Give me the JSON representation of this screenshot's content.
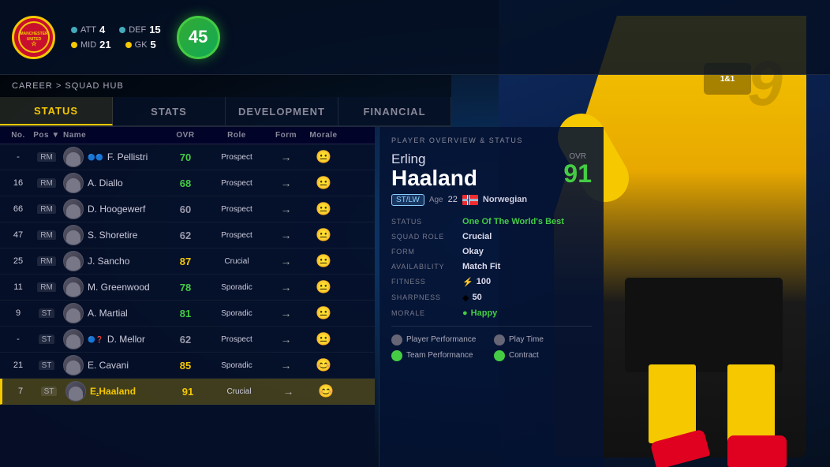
{
  "background": {
    "color": "#061428"
  },
  "topbar": {
    "club": "Manchester United",
    "stats": {
      "att_label": "ATT",
      "att_value": "4",
      "def_label": "DEF",
      "def_value": "15",
      "mid_label": "MID",
      "mid_value": "21",
      "gk_label": "GK",
      "gk_value": "5"
    },
    "overall": "45"
  },
  "breadcrumb": "CAREER > SQUAD HUB",
  "tabs": [
    {
      "label": "STATUS",
      "active": true
    },
    {
      "label": "STATS",
      "active": false
    },
    {
      "label": "DEVELOPMENT",
      "active": false
    },
    {
      "label": "FINANCIAL",
      "active": false
    }
  ],
  "table": {
    "headers": [
      "No.",
      "Pos ▼",
      "Name",
      "OVR",
      "Role",
      "Form",
      "Morale"
    ],
    "rows": [
      {
        "number": "-",
        "pos": "RM",
        "name": "F. Pellistri",
        "ovr": 70,
        "ovr_color": "green",
        "role": "Prospect",
        "form": "→",
        "morale": "😐",
        "selected": false,
        "special": "🔵🔵"
      },
      {
        "number": "16",
        "pos": "RM",
        "name": "A. Diallo",
        "ovr": 68,
        "ovr_color": "green",
        "role": "Prospect",
        "form": "→",
        "morale": "😐",
        "selected": false,
        "special": ""
      },
      {
        "number": "66",
        "pos": "RM",
        "name": "D. Hoogewerf",
        "ovr": 60,
        "ovr_color": "gray",
        "role": "Prospect",
        "form": "→",
        "morale": "😐",
        "selected": false,
        "special": ""
      },
      {
        "number": "47",
        "pos": "RM",
        "name": "S. Shoretire",
        "ovr": 62,
        "ovr_color": "gray",
        "role": "Prospect",
        "form": "→",
        "morale": "😐",
        "selected": false,
        "special": ""
      },
      {
        "number": "25",
        "pos": "RM",
        "name": "J. Sancho",
        "ovr": 87,
        "ovr_color": "yellow",
        "role": "Crucial",
        "form": "→",
        "morale": "😐",
        "selected": false,
        "special": ""
      },
      {
        "number": "11",
        "pos": "RM",
        "name": "M. Greenwood",
        "ovr": 78,
        "ovr_color": "green",
        "role": "Sporadic",
        "form": "→",
        "morale": "😐",
        "selected": false,
        "special": ""
      },
      {
        "number": "9",
        "pos": "ST",
        "name": "A. Martial",
        "ovr": 81,
        "ovr_color": "green",
        "role": "Sporadic",
        "form": "→",
        "morale": "😐",
        "selected": false,
        "special": ""
      },
      {
        "number": "-",
        "pos": "ST",
        "name": "D. Mellor",
        "ovr": 62,
        "ovr_color": "gray",
        "role": "Prospect",
        "form": "→",
        "morale": "😐",
        "selected": false,
        "special": "🔵❓"
      },
      {
        "number": "21",
        "pos": "ST",
        "name": "E. Cavani",
        "ovr": 85,
        "ovr_color": "yellow",
        "role": "Sporadic",
        "form": "→",
        "morale": "😊",
        "selected": false,
        "special": ""
      },
      {
        "number": "7",
        "pos": "ST",
        "name": "E.Haaland",
        "ovr": 91,
        "ovr_color": "yellow",
        "role": "Crucial",
        "form": "→",
        "morale": "😊",
        "selected": true,
        "special": ""
      }
    ]
  },
  "overview": {
    "title": "PLAYER OVERVIEW & STATUS",
    "first_name": "Erling",
    "last_name": "Haaland",
    "ovr_label": "OVR",
    "ovr_value": "91",
    "position": "ST/LW",
    "age_label": "Age",
    "age": "22",
    "nationality": "Norwegian",
    "stats": [
      {
        "key": "STATUS",
        "value": "One Of The World's Best",
        "color": "green"
      },
      {
        "key": "SQUAD ROLE",
        "value": "Crucial",
        "color": "white"
      },
      {
        "key": "FORM",
        "value": "Okay",
        "color": "white"
      },
      {
        "key": "AVAILABILITY",
        "value": "Match Fit",
        "color": "white"
      },
      {
        "key": "FITNESS",
        "value": "100",
        "icon": "⚡",
        "color": "white"
      },
      {
        "key": "SHARPNESS",
        "value": "50",
        "icon": "◆",
        "color": "white"
      },
      {
        "key": "MORALE",
        "value": "Happy",
        "icon": "●",
        "color": "green"
      }
    ],
    "reports": [
      {
        "label": "Player Performance",
        "type": "gray"
      },
      {
        "label": "Play Time",
        "type": "gray"
      },
      {
        "label": "Team Performance",
        "type": "green"
      },
      {
        "label": "Contract",
        "type": "green"
      }
    ]
  }
}
